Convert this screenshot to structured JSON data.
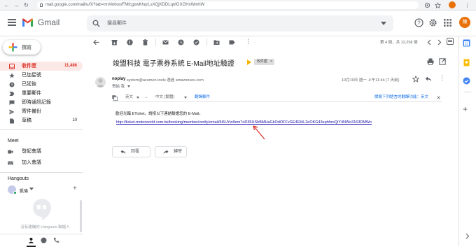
{
  "browser": {
    "url": "mail.google.com/mail/u/0/?tab=rm#inbox/FMfcgxwKhqrLsXQjKDDLqnfGXGHxWmhW"
  },
  "header": {
    "app_name": "Gmail",
    "search_placeholder": "搜尋郵件",
    "avatar_letter": "陳"
  },
  "sidebar": {
    "compose_label": "撰寫",
    "items": [
      {
        "label": "收件匣",
        "count": "11,486",
        "icon": "inbox-icon",
        "active": true
      },
      {
        "label": "已加星號",
        "count": "",
        "icon": "star-icon"
      },
      {
        "label": "已延後",
        "count": "",
        "icon": "clock-icon"
      },
      {
        "label": "重要郵件",
        "count": "",
        "icon": "label-icon"
      },
      {
        "label": "即時通訊記錄",
        "count": "",
        "icon": "chat-icon"
      },
      {
        "label": "寄件備份",
        "count": "",
        "icon": "send-icon"
      },
      {
        "label": "草稿",
        "count": "10",
        "icon": "draft-icon"
      }
    ],
    "meet_title": "Meet",
    "meet_items": [
      {
        "label": "發起會議",
        "icon": "video-icon"
      },
      {
        "label": "加入會議",
        "icon": "keyboard-icon"
      }
    ],
    "hangouts_title": "Hangouts",
    "hangouts_user": "凱倫",
    "hangouts_empty": "沒有建議的 Hangouts 聯絡人"
  },
  "toolbar": {
    "pager": "第 4 個，共 12,258 個"
  },
  "message": {
    "subject": "竣盟科技 電子票券系統 E-Mail地址驗證",
    "tag": "收件匣",
    "tag_close": "×",
    "sender_name": "noplay",
    "sender_email": "system@acumen.tools 透過 amazonses.com",
    "recipient": "寄給 我",
    "date": "10月19日 週一 上午11:44 (7 天前)",
    "translate_from": "英文",
    "translate_arrow": "→",
    "translate_to": "中文 (繁體)",
    "translate_link": "翻譯郵件",
    "translate_off": "關閉下列語言的翻譯功能：英文",
    "body_line": "歡迎光臨 ETicket，請按以下連結驗證您的 E-Mail。",
    "verify_url": "http://ticket.motorworld.com.tw/booking/member/verify/email/4i5UYw9em7oD35UShBMHaGkOdOFFvGE4EKiL2eOKG43ephhreQiY4NWo3163DMWo",
    "reply_label": "回覆",
    "forward_label": "轉寄"
  },
  "colors": {
    "accent_red": "#d93025",
    "active_bg": "#fce8e6",
    "link_blue": "#1a0dab",
    "tag_yellow": "#f4b400"
  }
}
